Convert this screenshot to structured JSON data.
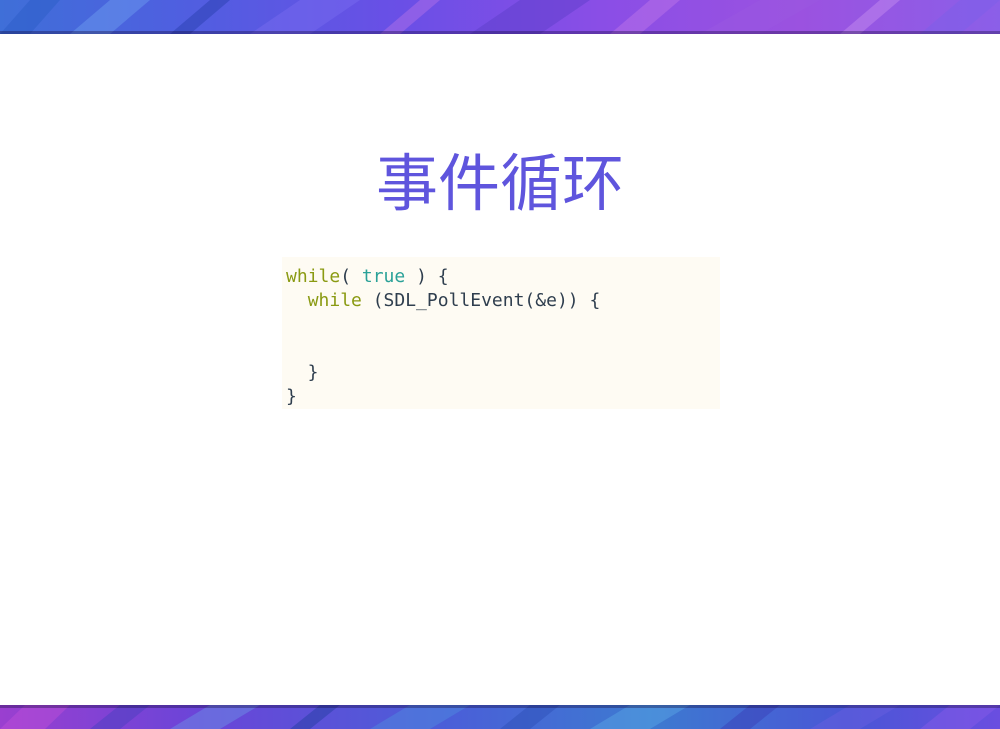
{
  "slide": {
    "title": "事件循环",
    "colors": {
      "title": "#5f55dd",
      "code_background": "#fefbf3",
      "keyword": "#8a9a12",
      "literal": "#2aa198",
      "text": "#2f3e4e"
    },
    "code": [
      [
        {
          "t": "while",
          "c": "kw"
        },
        {
          "t": "( ",
          "c": "txt"
        },
        {
          "t": "true",
          "c": "lit"
        },
        {
          "t": " ) {",
          "c": "txt"
        }
      ],
      [
        {
          "t": "  ",
          "c": "txt"
        },
        {
          "t": "while",
          "c": "kw"
        },
        {
          "t": " (SDL_PollEvent(&e)) {",
          "c": "txt"
        }
      ],
      [
        {
          "t": "",
          "c": "txt"
        }
      ],
      [
        {
          "t": "",
          "c": "txt"
        }
      ],
      [
        {
          "t": "  }",
          "c": "txt"
        }
      ],
      [
        {
          "t": "}",
          "c": "txt"
        }
      ]
    ]
  }
}
